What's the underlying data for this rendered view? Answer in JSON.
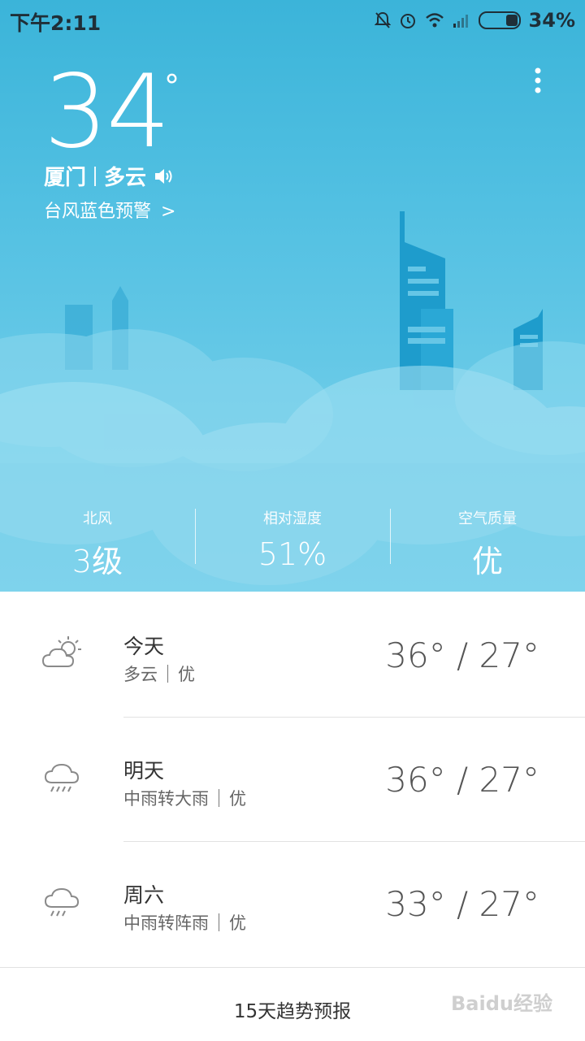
{
  "status_bar": {
    "time": "下午2:11",
    "battery_percent": "34%",
    "icons": [
      "mute-icon",
      "alarm-icon",
      "wifi-icon",
      "signal-icon",
      "battery-icon"
    ]
  },
  "current": {
    "temperature": "34",
    "degree": "°",
    "city": "厦门",
    "condition": "多云",
    "warning": "台风蓝色预警",
    "warning_arrow": ">"
  },
  "stats": [
    {
      "label": "北风",
      "value": "3级"
    },
    {
      "label": "相对湿度",
      "value": "51%"
    },
    {
      "label": "空气质量",
      "value": "优"
    }
  ],
  "forecast": [
    {
      "day": "今天",
      "condition": "多云",
      "aqi": "优",
      "temps": "36° / 27°",
      "icon": "partly-cloudy-icon"
    },
    {
      "day": "明天",
      "condition": "中雨转大雨",
      "aqi": "优",
      "temps": "36° / 27°",
      "icon": "rain-cloud-icon"
    },
    {
      "day": "周六",
      "condition": "中雨转阵雨",
      "aqi": "优",
      "temps": "33° / 27°",
      "icon": "rain-cloud-icon"
    }
  ],
  "bottom_button": "15天趋势预报",
  "watermark": "Baidu经验",
  "colors": {
    "sky_top": "#3bb4d9",
    "sky_bottom": "#77d2ec",
    "text_dark": "#333333"
  }
}
